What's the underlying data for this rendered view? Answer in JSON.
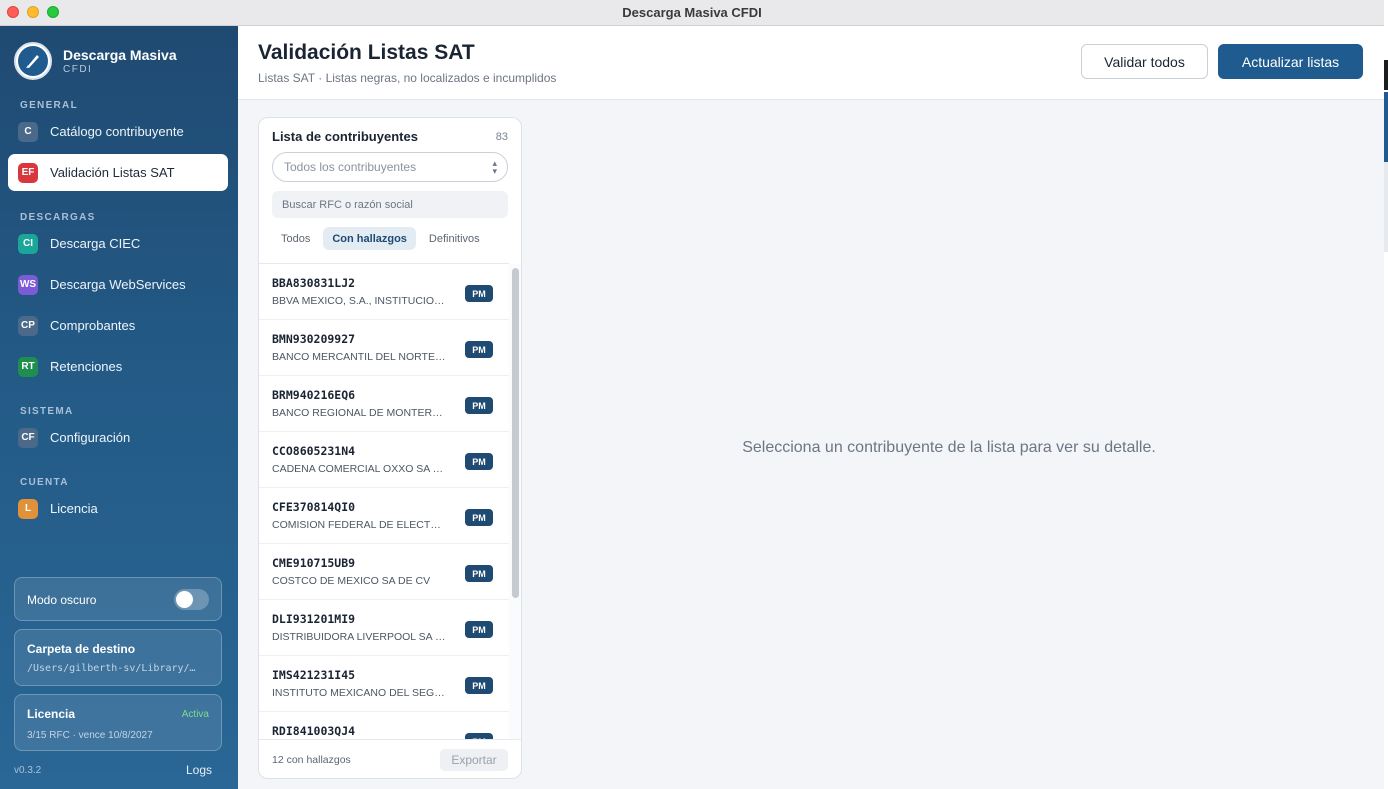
{
  "window": {
    "title": "Descarga Masiva CFDI"
  },
  "brand": {
    "title": "Descarga Masiva",
    "subtitle": "CFDI"
  },
  "sidebar": {
    "sections": {
      "general": "GENERAL",
      "descargas": "DESCARGAS",
      "sistema": "SISTEMA",
      "cuenta": "CUENTA"
    },
    "items": [
      {
        "badge": "C",
        "label": "Catálogo contribuyente",
        "color": "#4b6a8a"
      },
      {
        "badge": "EF",
        "label": "Validación Listas SAT",
        "color": "#d9363e",
        "active": true
      },
      {
        "badge": "CI",
        "label": "Descarga CIEC",
        "color": "#1aa79a"
      },
      {
        "badge": "WS",
        "label": "Descarga WebServices",
        "color": "#7b5bd6"
      },
      {
        "badge": "CP",
        "label": "Comprobantes",
        "color": "#4b6a8a"
      },
      {
        "badge": "RT",
        "label": "Retenciones",
        "color": "#1e8f4e"
      },
      {
        "badge": "CF",
        "label": "Configuración",
        "color": "#4b6a8a"
      },
      {
        "badge": "L",
        "label": "Licencia",
        "color": "#e0913a"
      }
    ],
    "dark_mode": {
      "label": "Modo oscuro",
      "enabled": false
    },
    "folder": {
      "title": "Carpeta de destino",
      "path": "/Users/gilberth-sv/Library/…"
    },
    "license": {
      "title": "Licencia",
      "status": "Activa",
      "detail": "3/15 RFC · vence 10/8/2027",
      "status_color": "#7ddc8a"
    },
    "version": "v0.3.2",
    "logs_label": "Logs"
  },
  "header": {
    "title": "Validación Listas SAT",
    "subtitle": "Listas SAT · Listas negras, no localizados e incumplidos",
    "validate_all": "Validar todos",
    "update_lists": "Actualizar listas"
  },
  "panel": {
    "title": "Lista de contribuyentes",
    "count": "83",
    "select_placeholder": "Todos los contribuyentes",
    "search_placeholder": "Buscar RFC o razón social",
    "tabs": [
      "Todos",
      "Con hallazgos",
      "Definitivos"
    ],
    "active_tab": 1,
    "rows": [
      {
        "rfc": "BBA830831LJ2",
        "name": "BBVA MEXICO, S.A., INSTITUCION DE BANCA MULTIPLE",
        "tag": "PM"
      },
      {
        "rfc": "BMN930209927",
        "name": "BANCO MERCANTIL DEL NORTE S.A.",
        "tag": "PM"
      },
      {
        "rfc": "BRM940216EQ6",
        "name": "BANCO REGIONAL DE MONTERREY S.A.",
        "tag": "PM"
      },
      {
        "rfc": "CCO8605231N4",
        "name": "CADENA COMERCIAL OXXO SA DE CV",
        "tag": "PM"
      },
      {
        "rfc": "CFE370814QI0",
        "name": "COMISION FEDERAL DE ELECTRICIDAD",
        "tag": "PM"
      },
      {
        "rfc": "CME910715UB9",
        "name": "COSTCO DE MEXICO SA DE CV",
        "tag": "PM"
      },
      {
        "rfc": "DLI931201MI9",
        "name": "DISTRIBUIDORA LIVERPOOL SA DE CV",
        "tag": "PM"
      },
      {
        "rfc": "IMS421231I45",
        "name": "INSTITUTO MEXICANO DEL SEGURO SOCIAL",
        "tag": "PM"
      },
      {
        "rfc": "RDI841003QJ4",
        "name": "",
        "tag": "PM"
      }
    ],
    "footer_text": "12 con hallazgos",
    "export_label": "Exportar"
  },
  "detail": {
    "empty_message": "Selecciona un contribuyente de la lista para ver su detalle."
  }
}
